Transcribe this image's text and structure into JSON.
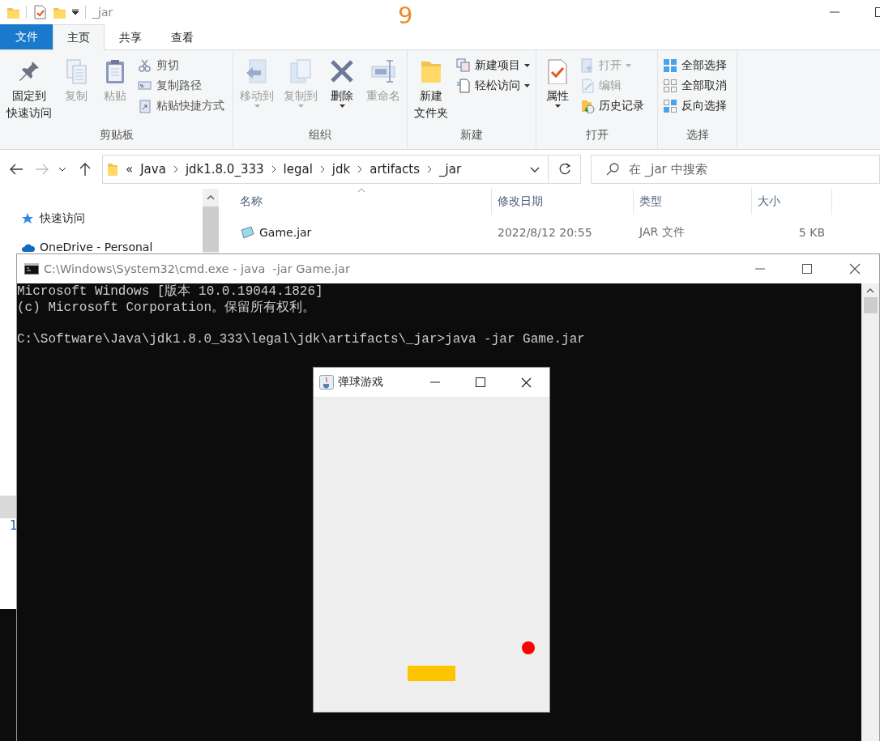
{
  "explorer": {
    "title": "_jar",
    "annotation": "9",
    "ribbon_tabs": [
      {
        "label": "文件",
        "kind": "menu",
        "selected": false
      },
      {
        "label": "主页",
        "kind": "tab",
        "selected": true
      },
      {
        "label": "共享",
        "kind": "tab",
        "selected": false
      },
      {
        "label": "查看",
        "kind": "tab",
        "selected": false
      }
    ],
    "ribbon_groups": [
      {
        "label": "剪贴板",
        "items": [
          {
            "kind": "large",
            "label": [
              "固定到",
              "快速访问"
            ],
            "disabled": false,
            "dropdown": false
          },
          {
            "kind": "large",
            "label": "复制",
            "disabled": true,
            "dropdown": false
          },
          {
            "kind": "large",
            "label": "粘贴",
            "disabled": true,
            "dropdown": false
          },
          {
            "kind": "small",
            "label": "剪切",
            "disabled": false,
            "dropdown": false
          },
          {
            "kind": "small",
            "label": "复制路径",
            "disabled": false,
            "dropdown": false
          },
          {
            "kind": "small",
            "label": "粘贴快捷方式",
            "disabled": false,
            "dropdown": false
          }
        ]
      },
      {
        "label": "组织",
        "items": [
          {
            "kind": "large",
            "label": "移动到",
            "disabled": true,
            "dropdown": true
          },
          {
            "kind": "large",
            "label": "复制到",
            "disabled": true,
            "dropdown": true
          },
          {
            "kind": "large",
            "label": "删除",
            "disabled": false,
            "dropdown": true
          },
          {
            "kind": "large",
            "label": "重命名",
            "disabled": true,
            "dropdown": false
          }
        ]
      },
      {
        "label": "新建",
        "items": [
          {
            "kind": "large",
            "label": [
              "新建",
              "文件夹"
            ],
            "disabled": false,
            "dropdown": false
          },
          {
            "kind": "small",
            "label": "新建项目",
            "disabled": false,
            "dropdown": true
          },
          {
            "kind": "small",
            "label": "轻松访问",
            "disabled": false,
            "dropdown": true
          }
        ]
      },
      {
        "label": "打开",
        "items": [
          {
            "kind": "large",
            "label": "属性",
            "disabled": false,
            "dropdown": true
          },
          {
            "kind": "small",
            "label": "打开",
            "disabled": true,
            "dropdown": true
          },
          {
            "kind": "small",
            "label": "编辑",
            "disabled": true,
            "dropdown": false
          },
          {
            "kind": "small",
            "label": "历史记录",
            "disabled": false,
            "dropdown": false
          }
        ]
      },
      {
        "label": "选择",
        "items": [
          {
            "kind": "small",
            "label": "全部选择",
            "disabled": false,
            "dropdown": false
          },
          {
            "kind": "small",
            "label": "全部取消",
            "disabled": false,
            "dropdown": false
          },
          {
            "kind": "small",
            "label": "反向选择",
            "disabled": false,
            "dropdown": false
          }
        ]
      }
    ],
    "address": {
      "overflow": "«",
      "path": [
        "Java",
        "jdk1.8.0_333",
        "legal",
        "jdk",
        "artifacts",
        "_jar"
      ]
    },
    "search": {
      "placeholder": "在 _jar 中搜索"
    },
    "navigation_pane": {
      "items": [
        {
          "label": "快速访问"
        },
        {
          "label": "OneDrive - Personal"
        }
      ]
    },
    "file_list": {
      "columns": [
        "名称",
        "修改日期",
        "类型",
        "大小"
      ],
      "rows": [
        {
          "name": "Game.jar",
          "modified": "2022/8/12 20:55",
          "type": "JAR 文件",
          "size": "5 KB"
        }
      ]
    },
    "status_bar": "1"
  },
  "console_window": {
    "title": "C:\\Windows\\System32\\cmd.exe - java  -jar Game.jar",
    "lines": [
      "Microsoft Windows [版本 10.0.19044.1826]",
      "(c) Microsoft Corporation。保留所有权利。"
    ],
    "prompt": "C:\\Software\\Java\\jdk1.8.0_333\\legal\\jdk\\artifacts\\_jar>java -jar Game.jar"
  },
  "game_window": {
    "title": "弹球游戏"
  }
}
